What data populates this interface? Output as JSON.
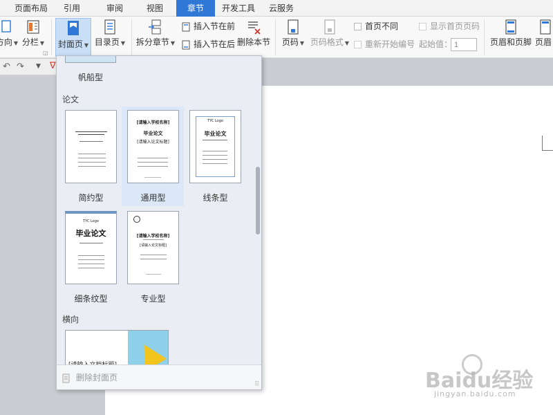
{
  "menu": {
    "tabs": [
      {
        "label": "页面布局"
      },
      {
        "label": "引用"
      },
      {
        "label": "审阅"
      },
      {
        "label": "视图"
      },
      {
        "label": "章节",
        "active": true
      },
      {
        "label": "开发工具"
      },
      {
        "label": "云服务"
      }
    ]
  },
  "ribbon": {
    "direction": "方向",
    "columns": "分栏",
    "cover_page": "封面页",
    "toc_page": "目录页",
    "split_section": "拆分章节",
    "insert_section_before": "插入节在前",
    "insert_section_after": "插入节在后",
    "delete_section": "删除本节",
    "page_number": "页码",
    "page_number_format": "页码格式",
    "first_page_different": "首页不同",
    "restart_numbering": "重新开始编号",
    "show_first_page_number": "显示首页页码",
    "start_value_label": "起始值：",
    "start_value": "1",
    "header_footer": "页眉和页脚",
    "header_cut": "页眉"
  },
  "panel": {
    "top_item": "帆船型",
    "section_thesis": "论文",
    "thumbs": [
      {
        "caption": "简约型"
      },
      {
        "caption": "通用型"
      },
      {
        "caption": "线条型"
      },
      {
        "caption": "细条纹型"
      },
      {
        "caption": "专业型"
      }
    ],
    "section_landscape": "横向",
    "landscape_text": "[请输入文档标题]",
    "thumb_text": {
      "grad_thesis": "毕业论文",
      "enter_title": "[请输入论文标题]",
      "school_name": "[请输入学校名称]",
      "logo_text": "TYC Logo"
    },
    "delete_cover": "删除封面页"
  },
  "watermark": {
    "brand": "Baidu经验",
    "url": "jingyan.baidu.com"
  },
  "colors": {
    "accent": "#2f78d6",
    "selected": "#c9dff7",
    "panel_bg": "#eaeef4"
  }
}
